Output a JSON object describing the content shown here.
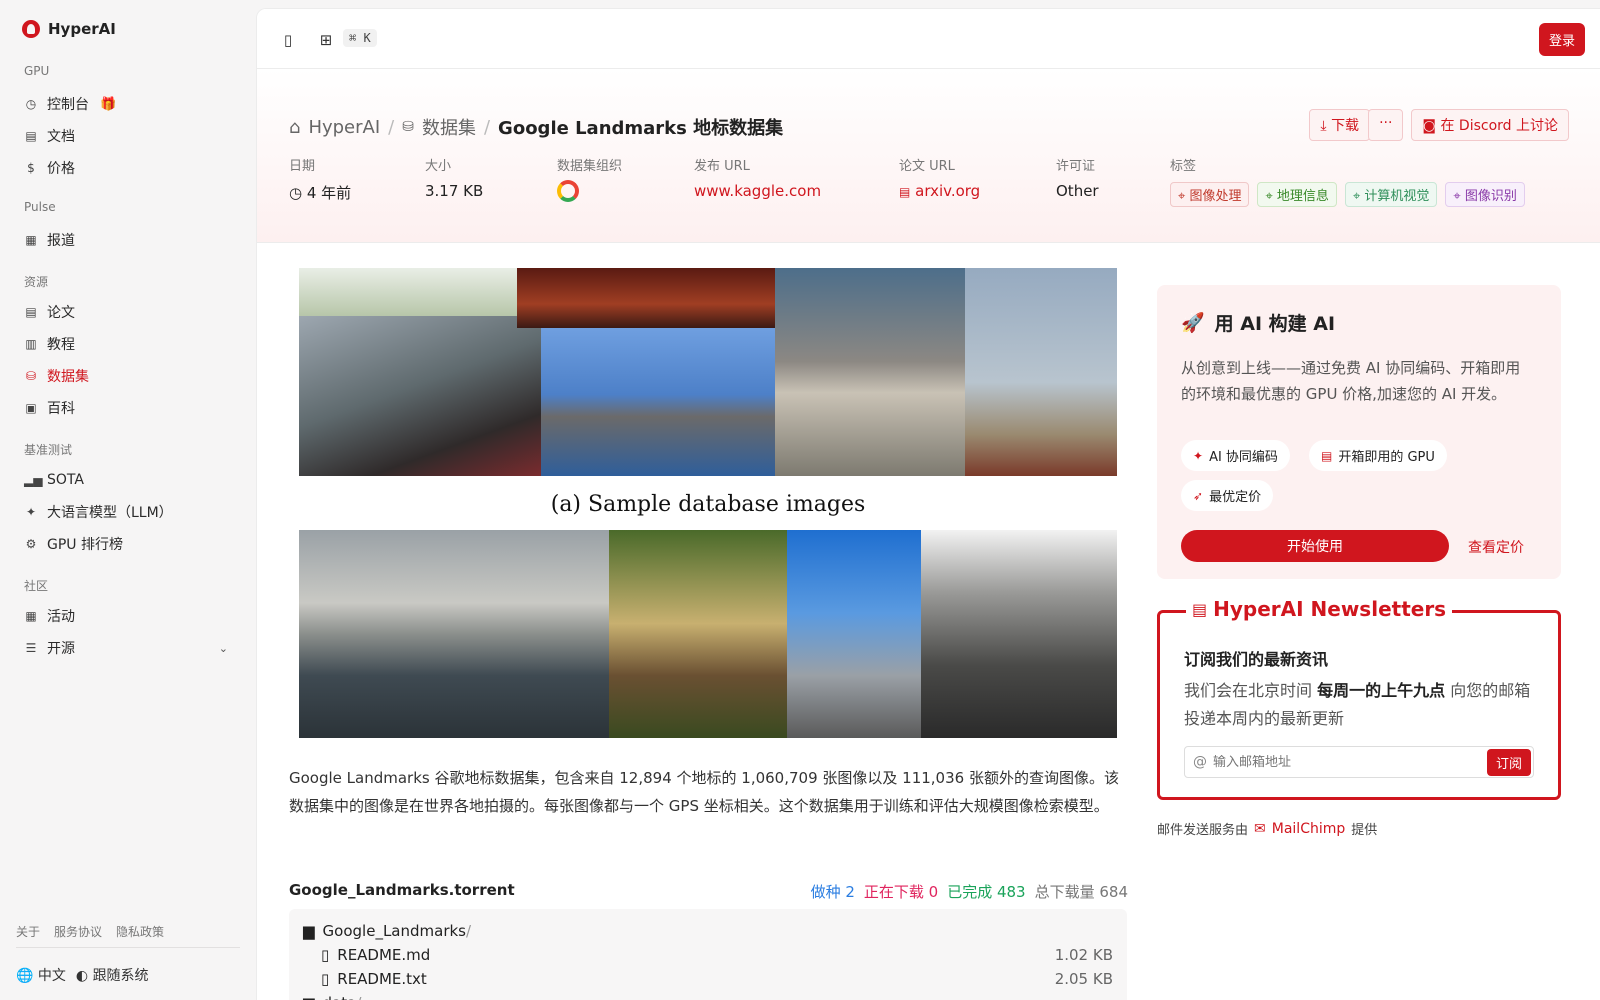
{
  "app": {
    "name": "HyperAI"
  },
  "sidebar": {
    "sections": [
      {
        "title": "GPU",
        "items": [
          {
            "label": "控制台",
            "icon": "dashboard-icon",
            "badge_icon": "gift-icon"
          },
          {
            "label": "文档",
            "icon": "document-icon"
          },
          {
            "label": "价格",
            "icon": "dollar-icon"
          }
        ]
      },
      {
        "title": "Pulse",
        "items": [
          {
            "label": "报道",
            "icon": "newspaper-icon"
          }
        ]
      },
      {
        "title": "资源",
        "items": [
          {
            "label": "论文",
            "icon": "paper-icon"
          },
          {
            "label": "教程",
            "icon": "book-icon"
          },
          {
            "label": "数据集",
            "icon": "database-icon",
            "active": true
          },
          {
            "label": "百科",
            "icon": "encyclopedia-icon"
          }
        ]
      },
      {
        "title": "基准测试",
        "items": [
          {
            "label": "SOTA",
            "icon": "bar-chart-icon"
          },
          {
            "label": "大语言模型（LLM）",
            "icon": "sparkle-icon"
          },
          {
            "label": "GPU 排行榜",
            "icon": "chip-icon"
          }
        ]
      },
      {
        "title": "社区",
        "items": [
          {
            "label": "活动",
            "icon": "calendar-icon"
          },
          {
            "label": "开源",
            "icon": "list-icon",
            "expandable": true
          }
        ]
      }
    ],
    "footer_links": [
      "关于",
      "服务协议",
      "隐私政策"
    ],
    "language": "中文",
    "theme": "跟随系统"
  },
  "topbar": {
    "shortcut": "⌘ K",
    "login_label": "登录"
  },
  "header": {
    "breadcrumb": {
      "root": "HyperAI",
      "section": "数据集",
      "current": "Google Landmarks 地标数据集"
    },
    "actions": {
      "download": "下载",
      "more": "···",
      "discord": "在 Discord 上讨论"
    },
    "meta": {
      "date": {
        "label": "日期",
        "value": "4 年前"
      },
      "size": {
        "label": "大小",
        "value": "3.17 KB"
      },
      "org": {
        "label": "数据集组织",
        "value": "google-logo"
      },
      "release_url": {
        "label": "发布 URL",
        "value": "www.kaggle.com"
      },
      "paper_url": {
        "label": "论文 URL",
        "value": "arxiv.org"
      },
      "license": {
        "label": "许可证",
        "value": "Other"
      },
      "tags": {
        "label": "标签",
        "items": [
          {
            "text": "图像处理",
            "color": "#c0392b",
            "bg": "#fdf0f0",
            "border": "#f0c8c8"
          },
          {
            "text": "地理信息",
            "color": "#3a8a2a",
            "bg": "#f2f9ef",
            "border": "#cfe7c5"
          },
          {
            "text": "计算机视觉",
            "color": "#2f8f5a",
            "bg": "#eff8f2",
            "border": "#c9e6d5"
          },
          {
            "text": "图像识别",
            "color": "#8a3aa8",
            "bg": "#f8f0fb",
            "border": "#e3cdee"
          }
        ]
      }
    }
  },
  "hero": {
    "caption": "(a) Sample database images"
  },
  "description": "Google Landmarks 谷歌地标数据集，包含来自 12,894 个地标的 1,060,709 张图像以及 111,036 张额外的查询图像。该数据集中的图像是在世界各地拍摄的。每张图像都与一个 GPS 坐标相关。这个数据集用于训练和评估大规模图像检索模型。",
  "torrent": {
    "name": "Google_Landmarks.torrent",
    "seeding": "做种 2",
    "downloading": "正在下载 0",
    "completed": "已完成 483",
    "total": "总下载量 684",
    "files": [
      {
        "name": "Google_Landmarks",
        "type": "folder",
        "suffix": "/"
      },
      {
        "name": "README.md",
        "type": "file",
        "size": "1.02 KB"
      },
      {
        "name": "README.txt",
        "type": "file",
        "size": "2.05 KB"
      },
      {
        "name": "data",
        "type": "folder",
        "suffix": "/"
      }
    ]
  },
  "ai_card": {
    "title": "用 AI 构建 AI",
    "desc": "从创意到上线——通过免费 AI 协同编码、开箱即用的环境和最优惠的 GPU 价格,加速您的 AI 开发。",
    "pills": [
      "AI 协同编码",
      "开箱即用的 GPU",
      "最优定价"
    ],
    "start": "开始使用",
    "pricing": "查看定价"
  },
  "newsletter": {
    "title": "HyperAI Newsletters",
    "subtitle": "订阅我们的最新资讯",
    "desc_prefix": "我们会在北京时间 ",
    "desc_bold": "每周一的上午九点",
    "desc_suffix": " 向您的邮箱投递本周内的最新更新",
    "placeholder": "输入邮箱地址",
    "subscribe": "订阅",
    "note_prefix": "邮件发送服务由",
    "note_brand": "MailChimp",
    "note_suffix": "提供"
  },
  "colors": {
    "accent": "#d0161e",
    "seeding": "#2a7de1",
    "downloading": "#e0245e",
    "completed": "#1aa35a",
    "total": "#777777"
  }
}
